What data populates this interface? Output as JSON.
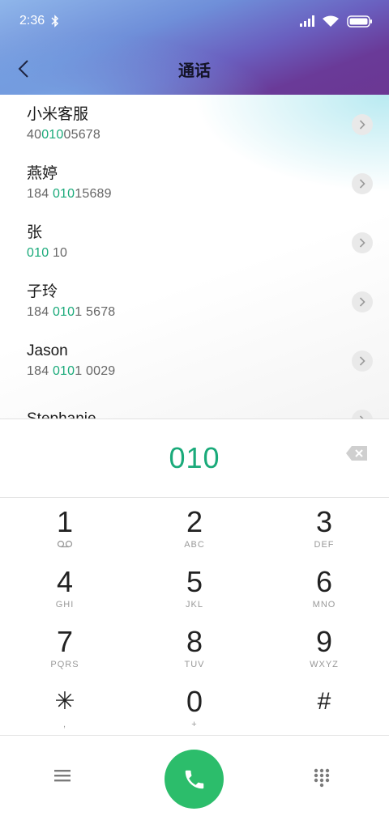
{
  "status_bar": {
    "time": "2:36"
  },
  "header": {
    "title": "通话"
  },
  "contacts": [
    {
      "name": "小米客服",
      "num_pre": "40",
      "num_hl": "010",
      "num_post": "05678"
    },
    {
      "name": "燕婷",
      "num_pre": "184 ",
      "num_hl": "010",
      "num_post": "15689"
    },
    {
      "name": "张",
      "num_pre": "",
      "num_hl": "010",
      "num_post": " 10"
    },
    {
      "name": "子玲",
      "num_pre": "184 ",
      "num_hl": "010",
      "num_post": "1 5678"
    },
    {
      "name": "Jason",
      "num_pre": "184 ",
      "num_hl": "010",
      "num_post": "1 0029"
    },
    {
      "name": "Stephanie",
      "num_pre": "",
      "num_hl": "",
      "num_post": ""
    }
  ],
  "dial_input": {
    "value": "010"
  },
  "keypad": [
    {
      "digit": "1",
      "letters": ""
    },
    {
      "digit": "2",
      "letters": "ABC"
    },
    {
      "digit": "3",
      "letters": "DEF"
    },
    {
      "digit": "4",
      "letters": "GHI"
    },
    {
      "digit": "5",
      "letters": "JKL"
    },
    {
      "digit": "6",
      "letters": "MNO"
    },
    {
      "digit": "7",
      "letters": "PQRS"
    },
    {
      "digit": "8",
      "letters": "TUV"
    },
    {
      "digit": "9",
      "letters": "WXYZ"
    },
    {
      "digit": "✳",
      "letters": ","
    },
    {
      "digit": "0",
      "letters": "+"
    },
    {
      "digit": "#",
      "letters": ""
    }
  ],
  "colors": {
    "accent": "#1aaa7a",
    "call": "#2cbd6b"
  },
  "icons": [
    "bluetooth-icon",
    "signal-icon",
    "wifi-icon",
    "battery-icon",
    "back-icon",
    "chevron-right-icon",
    "backspace-icon",
    "voicemail-icon",
    "menu-icon",
    "phone-icon",
    "dialpad-icon"
  ]
}
